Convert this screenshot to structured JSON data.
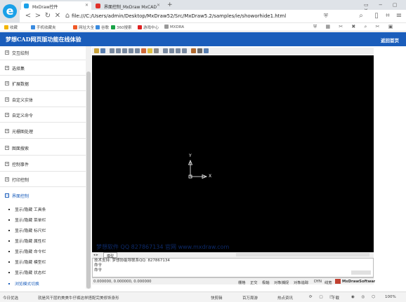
{
  "browser": {
    "tabs": [
      {
        "label": "MxDraw控件",
        "active": true
      },
      {
        "label": "界面控制_MxDraw MxCAD",
        "active": false
      }
    ],
    "new_tab": "+",
    "url": "file:///C:/Users/admin/Desktop/MxDraw52/Src/MxDraw5.2/samples/ie/showorhide1.html",
    "bookmarks": [
      {
        "label": "收藏",
        "color": "#f2b400"
      },
      {
        "label": "手机收藏夹",
        "color": "#3a8be0"
      },
      {
        "label": "网址大全",
        "color": "#f05a28"
      },
      {
        "label": "谷歌",
        "color": "#3a8be0"
      },
      {
        "label": "360搜索",
        "color": "#19a347"
      },
      {
        "label": "游戏中心",
        "color": "#e02020"
      },
      {
        "label": "MXDRA",
        "color": "#999999"
      }
    ]
  },
  "header": {
    "title": "梦想CAD网页版功能在线体验",
    "back": "返回首页"
  },
  "sidebar": {
    "items": [
      {
        "label": "交互绘制",
        "sign": "+"
      },
      {
        "label": "选择集",
        "sign": "+"
      },
      {
        "label": "扩展数据",
        "sign": "+"
      },
      {
        "label": "自定义实体",
        "sign": "+"
      },
      {
        "label": "自定义命令",
        "sign": "+"
      },
      {
        "label": "光栅图处理",
        "sign": "+"
      },
      {
        "label": "图面搜索",
        "sign": "+"
      },
      {
        "label": "控制事件",
        "sign": "+"
      },
      {
        "label": "打印控制",
        "sign": "+"
      },
      {
        "label": "界面控制",
        "sign": "−"
      }
    ],
    "subitems": [
      "显示/隐藏 工具条",
      "显示/隐藏 菜单栏",
      "显示/隐藏 标尺栏",
      "显示/隐藏 属性栏",
      "显示/隐藏 命令栏",
      "显示/隐藏 模型栏",
      "显示/隐藏 状态栏",
      "浏览模式切换"
    ],
    "active_color": "#1a5dbb"
  },
  "viewer": {
    "axis_x": "X",
    "axis_y": "Y",
    "watermark": "梦想软件 QQ 827867134 官网 www.mxdraw.com",
    "model_tab": "模型",
    "command_lines": [
      "技术支持: 梦想协能导联系QQ: 827867134",
      "命令",
      "命令"
    ],
    "coords": "0.000000, 0.000000, 0.000000",
    "status_toggles": [
      "栅格",
      "正交",
      "极轴",
      "对象捕捉",
      "对象追踪",
      "DYN",
      "线宽"
    ],
    "brand": "MxDrawSoftware"
  },
  "footer": {
    "left": [
      "今日优选",
      "就是风干层的美美牛仔裤这样搭配完美修饰身形"
    ],
    "right": [
      "快剪辑",
      "百万周游",
      "热点资讯",
      "下载",
      "100%"
    ]
  }
}
